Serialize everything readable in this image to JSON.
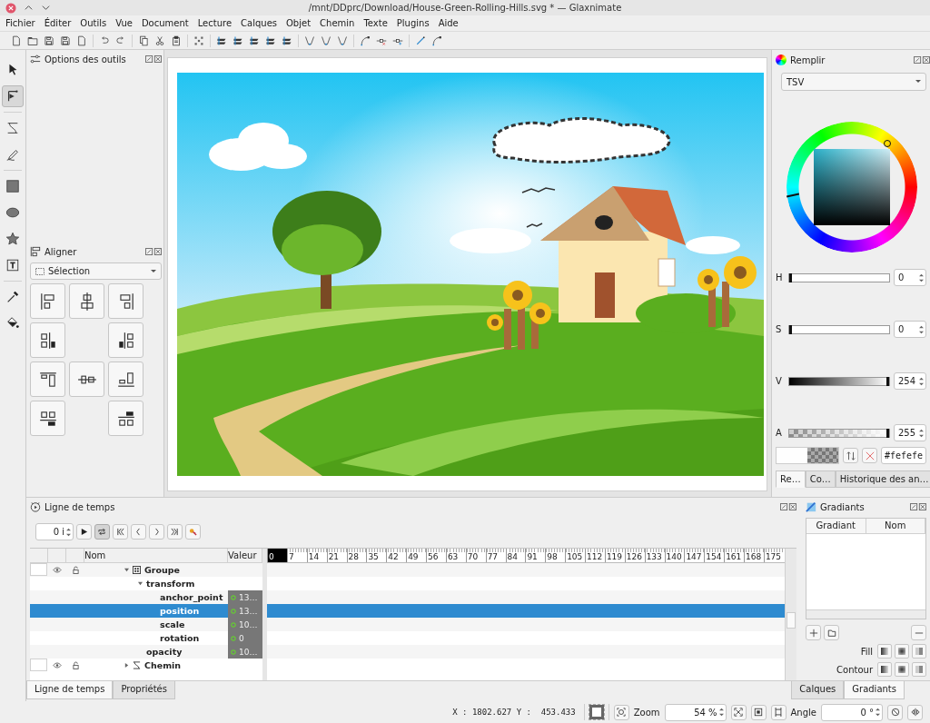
{
  "window": {
    "title": "/mnt/DDprc/Download/House-Green-Rolling-Hills.svg * — Glaxnimate"
  },
  "menu": [
    "Fichier",
    "Éditer",
    "Outils",
    "Vue",
    "Document",
    "Lecture",
    "Calques",
    "Objet",
    "Chemin",
    "Texte",
    "Plugins",
    "Aide"
  ],
  "tools": [
    {
      "kind": "select",
      "selected": false
    },
    {
      "kind": "edit",
      "selected": true
    },
    {
      "kind": "bezier",
      "selected": false
    },
    {
      "kind": "freehand",
      "selected": false
    },
    {
      "kind": "rectangle",
      "selected": false
    },
    {
      "kind": "ellipse",
      "selected": false
    },
    {
      "kind": "star",
      "selected": false
    },
    {
      "kind": "text",
      "selected": false
    },
    {
      "kind": "eyedropper",
      "selected": false
    },
    {
      "kind": "bucket",
      "selected": false
    }
  ],
  "tool_options": {
    "title": "Options des outils"
  },
  "align": {
    "title": "Aligner",
    "target": "Sélection"
  },
  "fill": {
    "title": "Remplir",
    "mode": "TSV",
    "sliders": [
      {
        "kind": "plain",
        "label": "H",
        "value": "0",
        "level": 0
      },
      {
        "kind": "plain",
        "label": "S",
        "value": "0",
        "level": 0
      },
      {
        "kind": "value",
        "label": "V",
        "value": "254",
        "level": 0.996
      },
      {
        "kind": "alpha",
        "label": "A",
        "value": "255",
        "level": 1
      }
    ],
    "hex": "#fefefe",
    "tabs": [
      {
        "label": "Re…",
        "selected": true
      },
      {
        "label": "Co…",
        "selected": false
      },
      {
        "label": "Historique des an…",
        "selected": false
      }
    ]
  },
  "timeline": {
    "title": "Ligne de temps",
    "frame": "0 i",
    "loop_on": true,
    "columns": [
      "Nom",
      "Valeur"
    ],
    "ruler": [
      "0",
      "7",
      "14",
      "21",
      "28",
      "35",
      "42",
      "49",
      "56",
      "63",
      "70",
      "77",
      "84",
      "91",
      "98",
      "105",
      "112",
      "119",
      "126",
      "133",
      "140",
      "147",
      "154",
      "161",
      "168",
      "175"
    ],
    "rows": [
      {
        "kind": "group",
        "name": "Groupe",
        "expanded": true,
        "selected": false,
        "children": [
          {
            "kind": "property",
            "name": "transform",
            "expanded": true,
            "selected": false,
            "children": [
              {
                "kind": "property",
                "name": "anchor_point",
                "value": "13…",
                "selected": false
              },
              {
                "kind": "property",
                "name": "position",
                "value": "13…",
                "selected": true
              },
              {
                "kind": "property",
                "name": "scale",
                "value": "10…",
                "selected": false
              },
              {
                "kind": "property",
                "name": "rotation",
                "value": "0",
                "selected": false
              }
            ]
          },
          {
            "kind": "property",
            "name": "opacity",
            "value": "10…",
            "selected": false
          }
        ]
      },
      {
        "kind": "path",
        "name": "Chemin",
        "expanded": false,
        "selected": false
      }
    ]
  },
  "gradients": {
    "title": "Gradiants",
    "columns": [
      "Gradiant",
      "Nom"
    ],
    "fill_label": "Fill",
    "stroke_label": "Contour"
  },
  "bottom_tabs_left": [
    {
      "label": "Ligne de temps",
      "selected": true
    },
    {
      "label": "Propriétés",
      "selected": false
    }
  ],
  "bottom_tabs_right": [
    {
      "label": "Calques",
      "selected": false
    },
    {
      "label": "Gradiants",
      "selected": true
    }
  ],
  "status": {
    "coords": "X : 1802.627 Y :  453.433",
    "zoom_label": "Zoom",
    "zoom": "54 %",
    "angle_label": "Angle",
    "angle": "0 °"
  }
}
